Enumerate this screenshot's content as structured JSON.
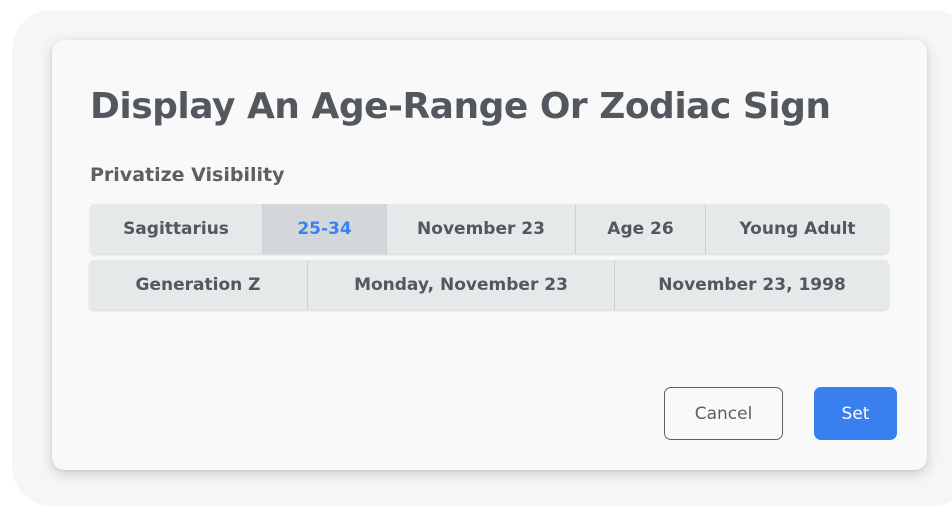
{
  "dialog": {
    "title": "Display An Age-Range Or Zodiac Sign",
    "subtitle": "Privatize Visibility",
    "row1": [
      "Sagittarius",
      "25-34",
      "November 23",
      "Age 26",
      "Young Adult"
    ],
    "row2": [
      "Generation Z",
      "Monday, November 23",
      "November 23, 1998"
    ],
    "selected": "25-34",
    "cancel_label": "Cancel",
    "set_label": "Set"
  },
  "colors": {
    "accent": "#3a7ff0",
    "title_text": "#53585e",
    "segment_bg": "#e6e9ea",
    "segment_selected_bg": "#d3d7da"
  }
}
